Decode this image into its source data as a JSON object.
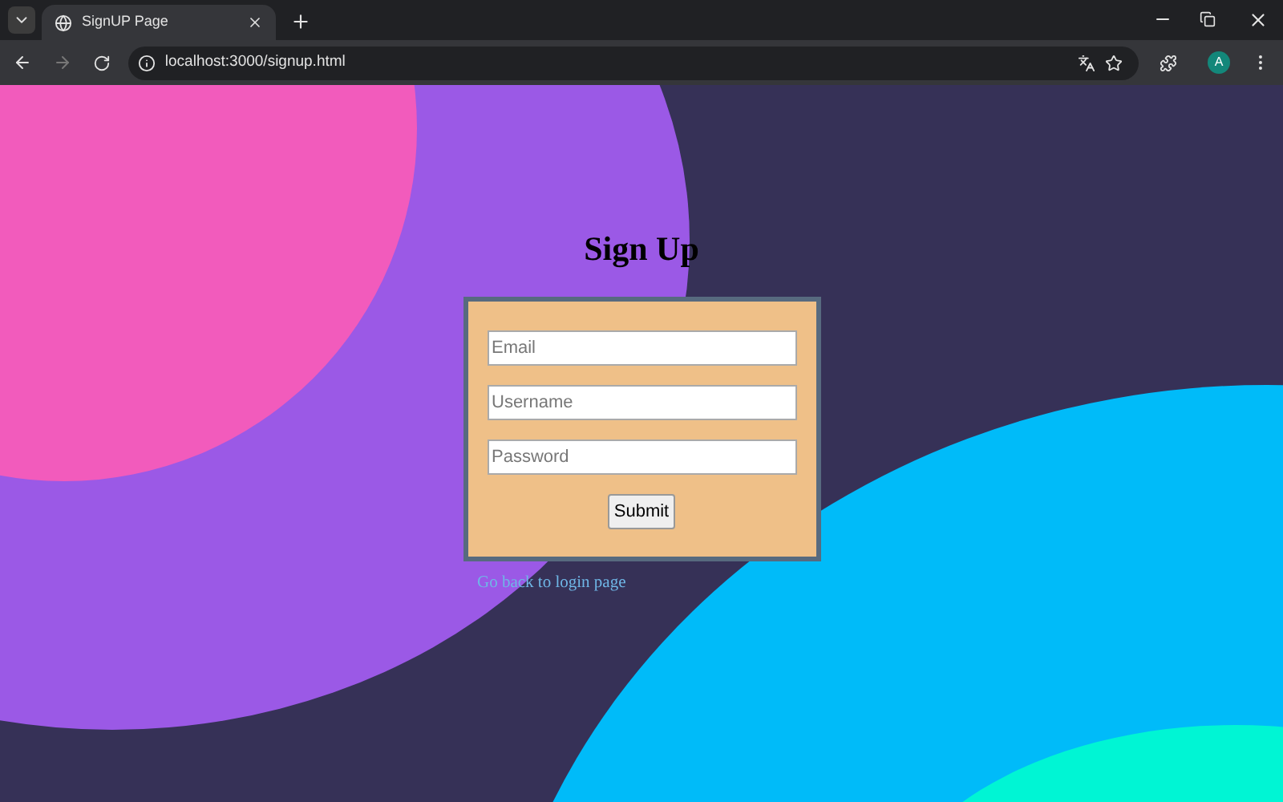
{
  "browser": {
    "tab_title": "SignUP Page",
    "url": "localhost:3000/signup.html",
    "profile_initial": "A"
  },
  "page": {
    "heading": "Sign Up",
    "fields": [
      {
        "placeholder": "Email"
      },
      {
        "placeholder": "Username"
      },
      {
        "placeholder": "Password"
      }
    ],
    "submit": "Submit",
    "link": "Go back to login page"
  }
}
